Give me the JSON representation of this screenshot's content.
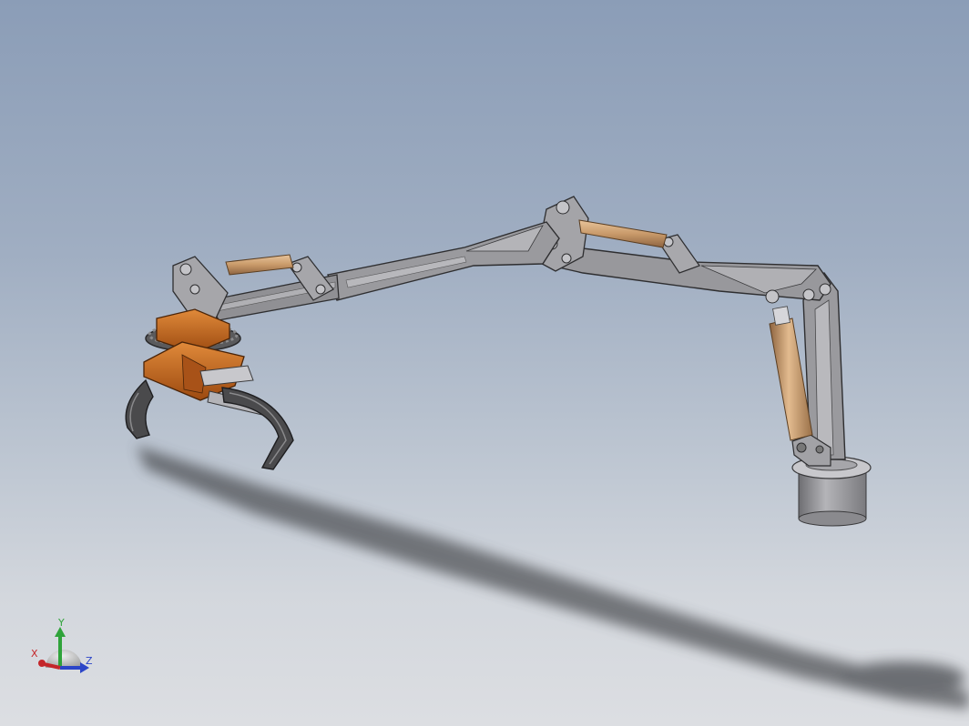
{
  "viewport": {
    "background_top": "#8b9db7",
    "background_bottom": "#dcdee2"
  },
  "model": {
    "parts": [
      "base-pedestal",
      "lift-cylinder",
      "column",
      "inner-boom",
      "boom-cylinder",
      "outer-boom",
      "extension-boom",
      "rotator",
      "grapple"
    ],
    "metal_color": "#8c8c90",
    "cylinder_color": "#c99a6a",
    "rotator_color": "#c8661d"
  },
  "triad": {
    "x_label": "X",
    "y_label": "Y",
    "z_label": "Z",
    "x_color": "#c4262a",
    "y_color": "#2fa33a",
    "z_color": "#2b45c8"
  }
}
